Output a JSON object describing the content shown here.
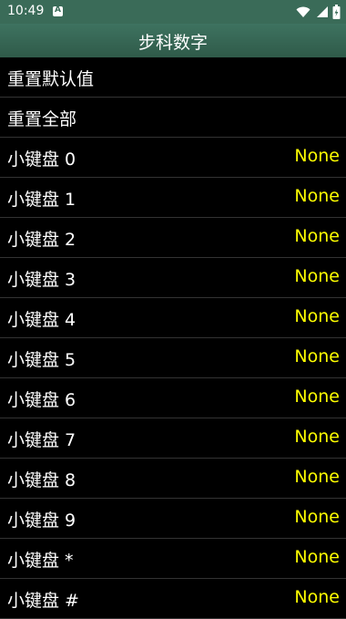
{
  "status_bar": {
    "time": "10:49",
    "icons": [
      "notification-a-icon",
      "wifi-icon",
      "signal-icon",
      "battery-icon"
    ]
  },
  "title": "步科数字",
  "colors": {
    "header_green": "#3a6b58",
    "value_yellow": "#ffff00",
    "background": "#000000",
    "divider": "#333333"
  },
  "actions": [
    {
      "label": "重置默认值"
    },
    {
      "label": "重置全部"
    }
  ],
  "keypad": [
    {
      "label": "小键盘 0",
      "value": "None"
    },
    {
      "label": "小键盘 1",
      "value": "None"
    },
    {
      "label": "小键盘 2",
      "value": "None"
    },
    {
      "label": "小键盘 3",
      "value": "None"
    },
    {
      "label": "小键盘 4",
      "value": "None"
    },
    {
      "label": "小键盘 5",
      "value": "None"
    },
    {
      "label": "小键盘 6",
      "value": "None"
    },
    {
      "label": "小键盘 7",
      "value": "None"
    },
    {
      "label": "小键盘 8",
      "value": "None"
    },
    {
      "label": "小键盘 9",
      "value": "None"
    },
    {
      "label": "小键盘 *",
      "value": "None"
    },
    {
      "label": "小键盘 #",
      "value": "None"
    }
  ]
}
